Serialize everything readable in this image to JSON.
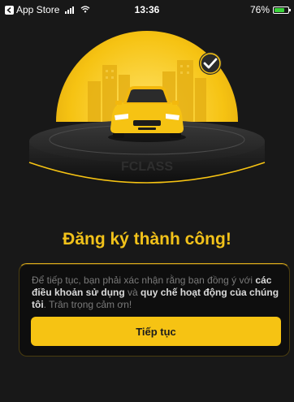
{
  "status_bar": {
    "back_app": "App Store",
    "time": "13:36",
    "battery": "76%"
  },
  "hero": {
    "platform_label": "FCLASS",
    "accent_color": "#f6c313"
  },
  "title": "Đăng ký thành công!",
  "info": {
    "text_1": "Để tiếp tục, bạn phải xác nhận rằng bạn đồng ý với ",
    "terms_link": "các điều khoản sử dụng",
    "text_2": " và ",
    "policy_link": "quy chế hoạt động của chúng tôi",
    "text_3": ". Trân trọng cảm ơn!"
  },
  "continue_button": "Tiếp tục"
}
